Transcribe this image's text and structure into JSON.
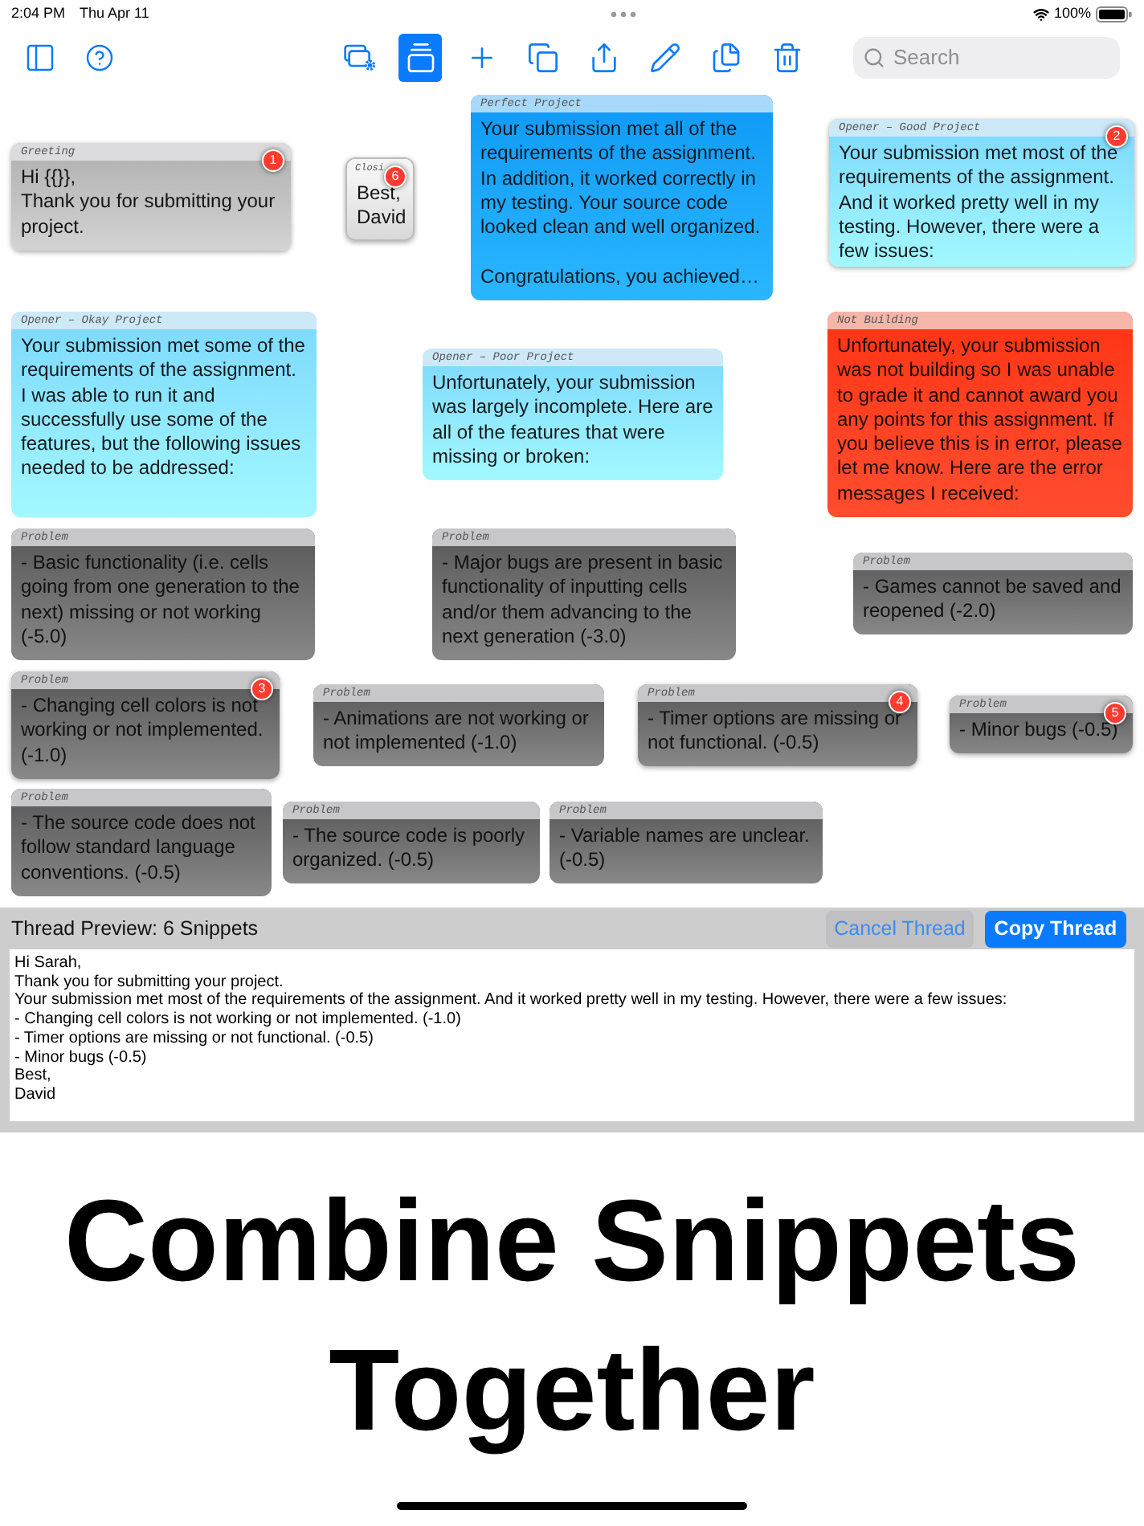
{
  "status_bar": {
    "time": "2:04 PM",
    "date": "Thu Apr 11",
    "battery": "100%"
  },
  "toolbar": {
    "tools": [
      {
        "selected": false
      },
      {
        "selected": true
      },
      {
        "selected": false
      },
      {
        "selected": false
      },
      {
        "selected": false
      },
      {
        "selected": false
      },
      {
        "selected": false
      },
      {
        "selected": false
      }
    ],
    "search": {
      "placeholder": "Search"
    }
  },
  "snippets": [
    {
      "kind": "greeting",
      "title": "Greeting",
      "text": "Hi {{}},\nThank you for submitting your project.",
      "badge": "1"
    },
    {
      "kind": "closing",
      "title": "Closi",
      "text": "Best,\nDavid",
      "badge": "6"
    },
    {
      "kind": "perfect",
      "title": "Perfect Project",
      "text": "Your submission met all of the requirements of the assignment. In addition, it worked correctly in my testing. Your source code looked clean and well organized.\n\nCongratulations, you achieved…"
    },
    {
      "kind": "opener",
      "title": "Opener – Good Project",
      "text": "Your submission met most of the requirements of the assignment. And it worked pretty well in my testing. However, there were a few issues:",
      "badge": "2"
    },
    {
      "kind": "opener",
      "title": "Opener – Okay Project",
      "text": "Your submission met some of the requirements of the assignment. I was able to run it and successfully use some of the features, but the following issues needed to be addressed:"
    },
    {
      "kind": "opener",
      "title": "Opener – Poor Project",
      "text": "Unfortunately, your submission was largely incomplete. Here are all of the features that were missing or broken:"
    },
    {
      "kind": "error",
      "title": "Not Building",
      "text": "Unfortunately, your submission was not building so I was unable to grade it and cannot award you any points for this assignment. If you believe this is in error, please let me know. Here are the error messages I received:"
    },
    {
      "kind": "problem",
      "title": "Problem",
      "text": "- Basic functionality (i.e. cells going from one generation to the next) missing or not working (-5.0)"
    },
    {
      "kind": "problem",
      "title": "Problem",
      "text": "- Major bugs are present in basic functionality of inputting cells and/or them advancing to the next generation (-3.0)"
    },
    {
      "kind": "problem",
      "title": "Problem",
      "text": "- Games cannot be saved and reopened (-2.0)"
    },
    {
      "kind": "problem",
      "title": "Problem",
      "text": "- Changing cell colors is not working or not implemented. (-1.0)",
      "badge": "3"
    },
    {
      "kind": "problem",
      "title": "Problem",
      "text": "- Animations are not working or not implemented (-1.0)"
    },
    {
      "kind": "problem",
      "title": "Problem",
      "text": "- Timer options are missing or not functional. (-0.5)",
      "badge": "4"
    },
    {
      "kind": "problem",
      "title": "Problem",
      "text": "- Minor bugs (-0.5)",
      "badge": "5"
    },
    {
      "kind": "problem",
      "title": "Problem",
      "text": "- The source code does not follow standard language conventions. (-0.5)"
    },
    {
      "kind": "problem",
      "title": "Problem",
      "text": "- The source code is poorly organized. (-0.5)"
    },
    {
      "kind": "problem",
      "title": "Problem",
      "text": "- Variable names are unclear. (-0.5)"
    }
  ],
  "thread": {
    "title": "Thread Preview: 6 Snippets",
    "buttons": [
      {
        "label": "Cancel Thread",
        "kind": "secondary"
      },
      {
        "label": "Copy Thread",
        "kind": "primary"
      }
    ],
    "value": "Hi Sarah,\nThank you for submitting your project.\nYour submission met most of the requirements of the assignment. And it worked pretty well in my testing. However, there were a few issues:\n- Changing cell colors is not working or not implemented. (-1.0)\n- Timer options are missing or not functional. (-0.5)\n- Minor bugs (-0.5)\nBest,\nDavid"
  },
  "headline": "Combine Snippets Together"
}
